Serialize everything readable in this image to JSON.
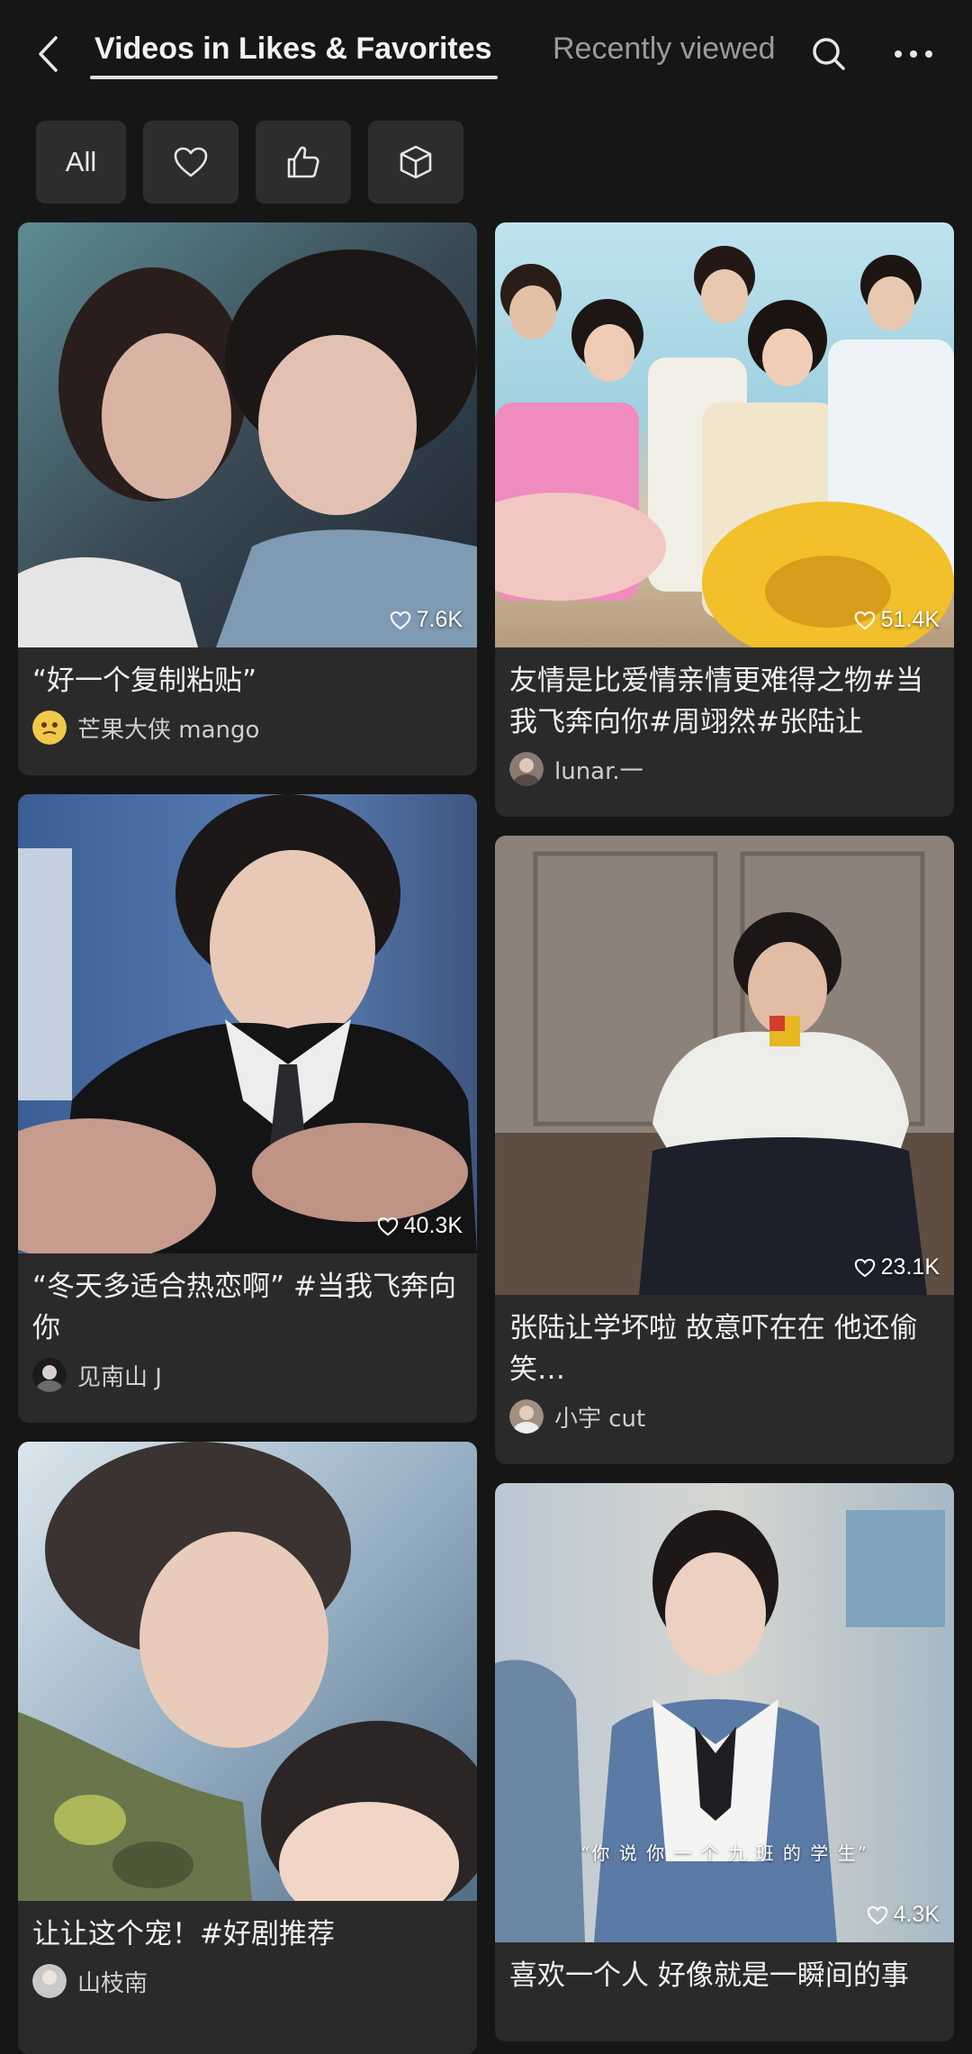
{
  "header": {
    "tab_active": "Videos in Likes & Favorites",
    "tab_inactive": "Recently viewed",
    "back_icon": "chevron-left-icon",
    "search_icon": "search-icon",
    "more_icon": "more-horizontal-icon"
  },
  "filters": {
    "all_label": "All",
    "chips": [
      "heart-icon",
      "thumbs-up-icon",
      "box-icon"
    ]
  },
  "colors": {
    "background": "#161616",
    "card": "#2a2a2a",
    "chip": "#2d2d2d"
  },
  "cards": [
    {
      "caption": "“好一个复制粘贴”",
      "author": "芒果大侠 mango",
      "likes": "7.6K"
    },
    {
      "caption": "友情是比爱情亲情更难得之物#当我飞奔向你#周翊然#张陆让",
      "author": "lunar.一",
      "likes": "51.4K"
    },
    {
      "caption": "“冬天多适合热恋啊” #当我飞奔向你",
      "author": "见南山 J",
      "likes": "40.3K"
    },
    {
      "caption": "张陆让学坏啦 故意吓在在 他还偷笑…",
      "author": "小宇 cut",
      "likes": "23.1K"
    },
    {
      "caption": "让让这个宠！#好剧推荐",
      "author": "山枝南",
      "likes": ""
    },
    {
      "caption": "喜欢一个人 好像就是一瞬间的事",
      "author": "",
      "likes": "4.3K",
      "overlay_text": "“你 说 你 一 个 九 班 的 学 生”"
    }
  ]
}
